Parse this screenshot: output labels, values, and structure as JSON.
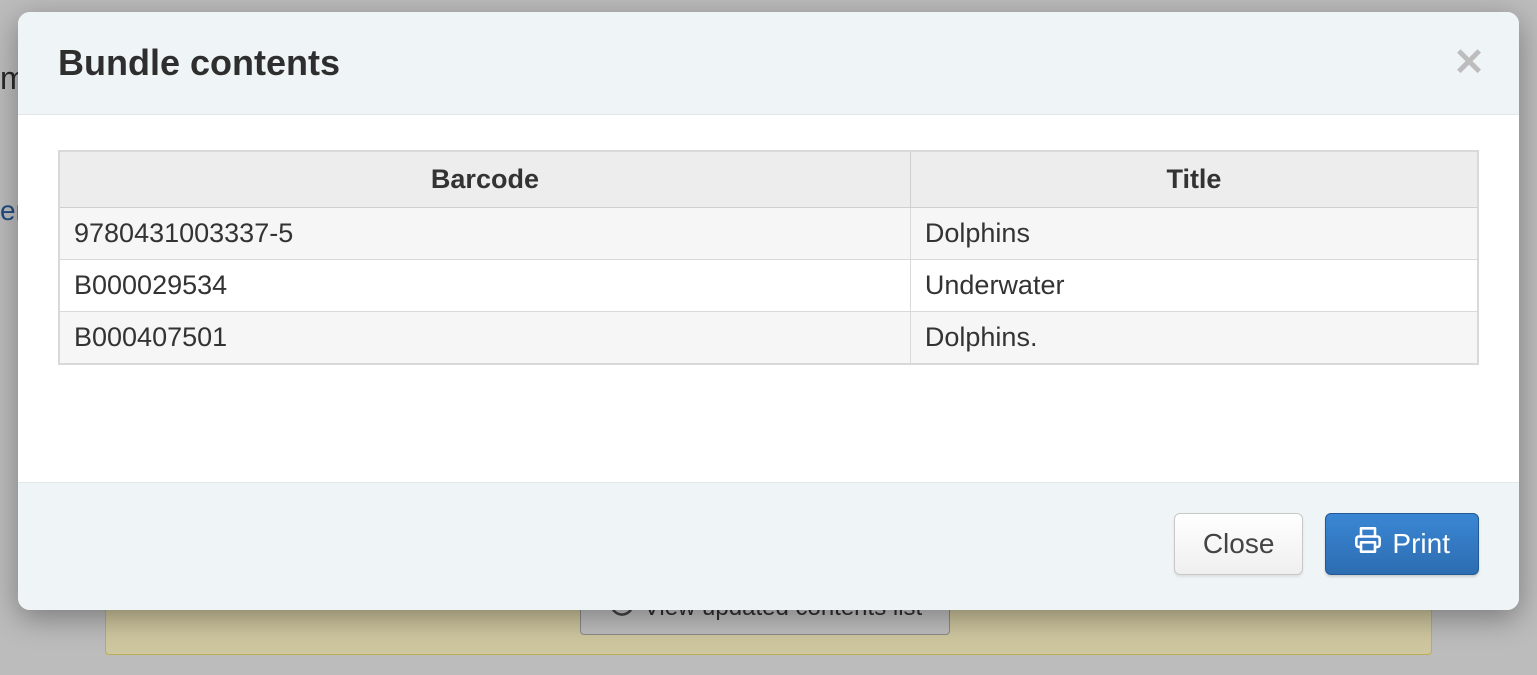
{
  "modal": {
    "title": "Bundle contents",
    "table": {
      "headers": {
        "barcode": "Barcode",
        "title": "Title"
      },
      "rows": [
        {
          "barcode": "9780431003337-5",
          "title": "Dolphins"
        },
        {
          "barcode": "B000029534",
          "title": "Underwater"
        },
        {
          "barcode": "B000407501",
          "title": "Dolphins."
        }
      ]
    },
    "footer": {
      "close_label": "Close",
      "print_label": "Print"
    }
  },
  "background": {
    "hidden_button_label": "View updated contents list"
  }
}
